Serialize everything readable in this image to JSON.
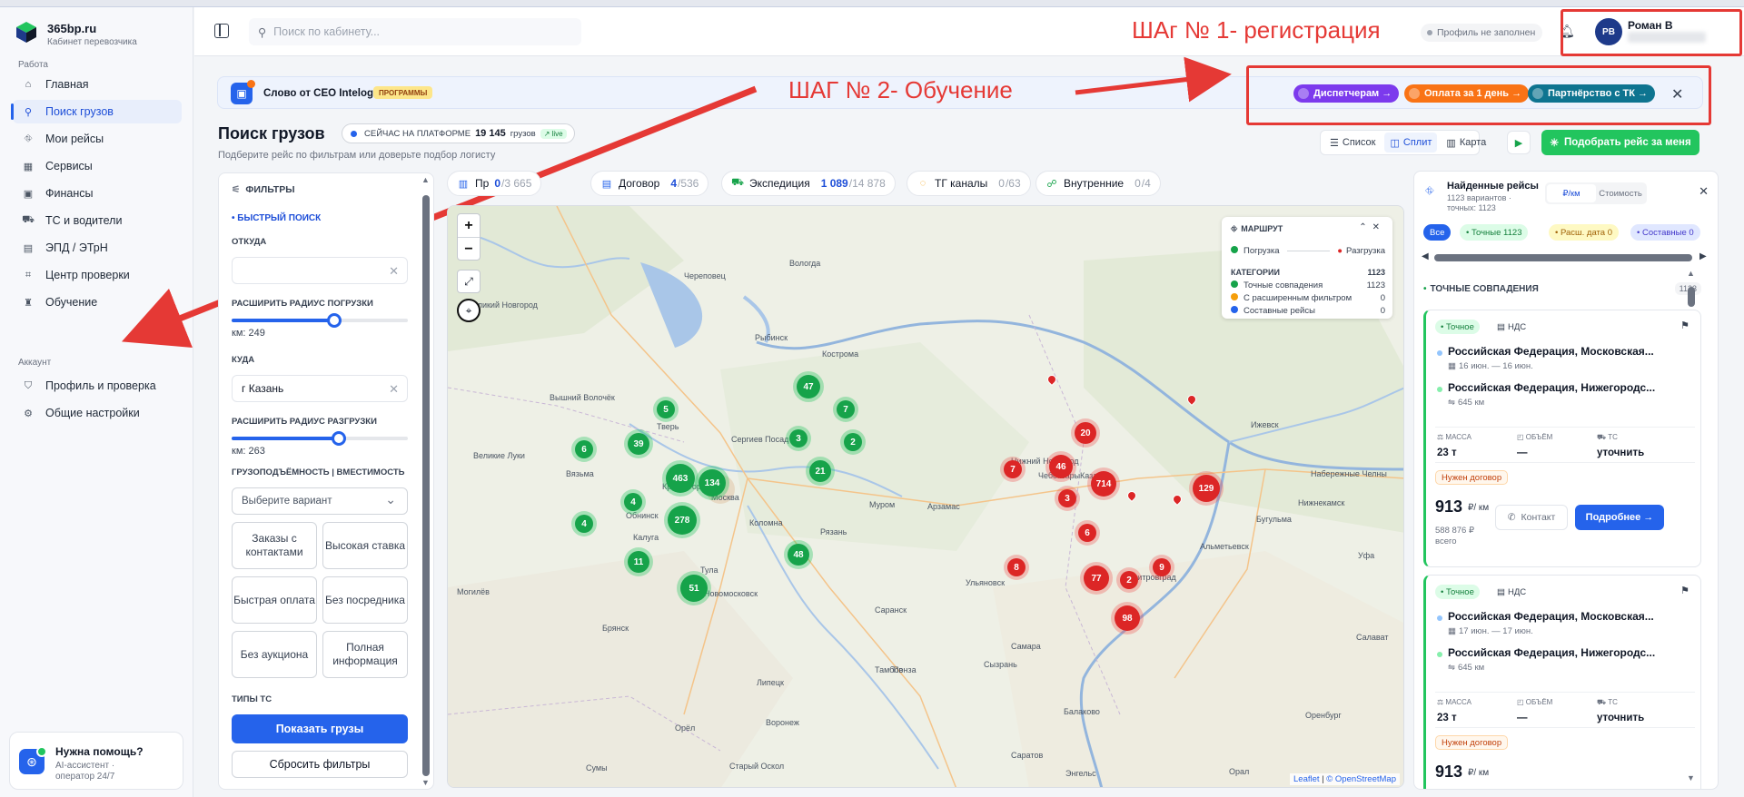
{
  "sidebar": {
    "brand": "365bp.ru",
    "brand_sub": "Кабинет перевозчика",
    "section_work": "Работа",
    "items": [
      {
        "label": "Главная",
        "icon": "home-icon"
      },
      {
        "label": "Поиск грузов",
        "icon": "search-icon"
      },
      {
        "label": "Мои рейсы",
        "icon": "route-icon"
      },
      {
        "label": "Сервисы",
        "icon": "grid-icon"
      },
      {
        "label": "Финансы",
        "icon": "wallet-icon"
      },
      {
        "label": "ТС и водители",
        "icon": "truck-icon"
      },
      {
        "label": "ЭПД / ЭТрН",
        "icon": "document-icon"
      },
      {
        "label": "Центр проверки",
        "icon": "scan-icon"
      },
      {
        "label": "Обучение",
        "icon": "graduation-icon"
      }
    ],
    "section_account": "Аккаунт",
    "account_items": [
      {
        "label": "Профиль и проверка",
        "icon": "shield-icon"
      },
      {
        "label": "Общие настройки",
        "icon": "gear-icon"
      }
    ],
    "help": {
      "title": "Нужна помощь?",
      "subtitle": "AI-ассистент · оператор 24/7"
    }
  },
  "header": {
    "search_placeholder": "Поиск по кабинету...",
    "profile_status": "Профиль не заполнен",
    "avatar_initials": "РВ",
    "user_name": "Роман В"
  },
  "annotations": {
    "step1": "ШАг № 1- регистрация",
    "step2": "ШАГ № 2- Обучение"
  },
  "banner": {
    "title": "Слово от CEO Intelogis",
    "tag": "ПРОГРАММЫ",
    "pills": [
      {
        "label": "Диспетчерам →",
        "color": "#7c3aed"
      },
      {
        "label": "Оплата за 1 день →",
        "color": "#f97316"
      },
      {
        "label": "Партнёрство с ТК →",
        "color": "#0e7490"
      }
    ]
  },
  "page": {
    "title": "Поиск грузов",
    "live_label": "СЕЙЧАС НА ПЛАТФОРМЕ",
    "live_count": "19 145",
    "live_unit": "грузов",
    "live_badge": "↗ live",
    "subtitle": "Подберите рейс по фильтрам или доверьте подбор логисту",
    "views": [
      "Список",
      "Сплит",
      "Карта"
    ],
    "pick_button": "Подобрать рейс за меня"
  },
  "filters": {
    "title": "ФИЛЬТРЫ",
    "quick": "• БЫСТРЫЙ ПОИСК",
    "from_label": "ОТКУДА",
    "from_value": "",
    "radius_load_label": "РАСШИРИТЬ РАДИУС ПОГРУЗКИ",
    "radius_load_value": "км: 249",
    "radius_load_fraction": 0.58,
    "to_label": "КУДА",
    "to_value": "г Казань",
    "radius_unload_label": "РАСШИРИТЬ РАДИУС РАЗГРУЗКИ",
    "radius_unload_value": "км: 263",
    "radius_unload_fraction": 0.61,
    "capacity_label": "ГРУЗОПОДЪЁМНОСТЬ | ВМЕСТИМОСТЬ",
    "capacity_placeholder": "Выберите вариант",
    "chips": [
      "Заказы с контактами",
      "Высокая ставка",
      "Быстрая оплата",
      "Без посредника",
      "Без аукциона",
      "Полная информация"
    ],
    "types_label": "ТИПЫ ТС",
    "show_button": "Показать грузы",
    "reset_button": "Сбросить фильтры"
  },
  "source_tabs": [
    {
      "label": "Пр",
      "count": "0",
      "total": "/3 665"
    },
    {
      "label": "Договор",
      "count": "4",
      "total": "/536"
    },
    {
      "label": "Экспедиция",
      "count": "1 089",
      "total": "/14 878"
    },
    {
      "label": "ТГ каналы",
      "count": "0",
      "total": "/63"
    },
    {
      "label": "Внутренние",
      "count": "0",
      "total": "/4"
    }
  ],
  "map": {
    "zoom_in": "+",
    "zoom_out": "−",
    "attribution_leaflet": "Leaflet",
    "attribution_osm": "© OpenStreetMap",
    "cities": [
      "Вологда",
      "Череповец",
      "Кострома",
      "Великий Новгород",
      "Рыбинск",
      "Тверь",
      "Сергиев Посад",
      "Москва",
      "Коломна",
      "Калуга",
      "Тула",
      "Рязань",
      "Муром",
      "Арзамас",
      "Нижний Новгород",
      "Чебоксары",
      "Казань",
      "Ижевск",
      "Набережные Челны",
      "Нижнекамск",
      "Ульяновск",
      "Саранск",
      "Пенза",
      "Самара",
      "Сызрань",
      "Уфа",
      "Брянск",
      "Орёл",
      "Липецк",
      "Воронеж",
      "Балаково",
      "Саратов",
      "Оренбург",
      "Вязьма",
      "Великие Луки",
      "Вышний Волочёк",
      "Новомосковск",
      "Старый Оскол",
      "Сумы",
      "Могилёв",
      "Тамбов",
      "Димитровград",
      "Альметьевск",
      "Бугульма",
      "Энгельс",
      "Обнинск",
      "Красногорск",
      "Салават",
      "Орал"
    ],
    "legend": {
      "title": "МАРШРУТ",
      "load": "Погрузка",
      "unload": "Разгрузка",
      "cat_label": "КАТЕГОРИИ",
      "cat_total": "1123",
      "rows": [
        {
          "label": "Точные совпадения",
          "value": "1123",
          "color": "#16a34a"
        },
        {
          "label": "С расширенным фильтром",
          "value": "0",
          "color": "#f59e0b"
        },
        {
          "label": "Составные рейсы",
          "value": "0",
          "color": "#2563eb"
        }
      ]
    },
    "green_clusters": [
      "47",
      "5",
      "7",
      "6",
      "39",
      "3",
      "2",
      "463",
      "134",
      "21",
      "4",
      "4",
      "278",
      "11",
      "48",
      "51"
    ],
    "red_clusters": [
      "20",
      "7",
      "46",
      "3",
      "714",
      "129",
      "6",
      "8",
      "77",
      "2",
      "9",
      "98"
    ]
  },
  "results": {
    "title": "Найденные рейсы",
    "subtitle": "1123 вариантов · точных: 1123",
    "mode": [
      "₽/км",
      "Стоимость"
    ],
    "tags": [
      {
        "label": "Все",
        "bg": "#2563eb",
        "fg": "#ffffff"
      },
      {
        "label": "• Точные 1123",
        "bg": "#dcfce7",
        "fg": "#15803d"
      },
      {
        "label": "• Расш. дата 0",
        "bg": "#fef9c3",
        "fg": "#a16207"
      },
      {
        "label": "• Составные 0",
        "bg": "#e0e7ff",
        "fg": "#4338ca"
      }
    ],
    "section": "ТОЧНЫЕ СОВПАДЕНИЯ",
    "section_count": "1123",
    "cards": [
      {
        "tag": "• Точное",
        "vat": "НДС",
        "from": "Российская Федерация, Московская...",
        "dates": "16 июн. — 16 июн.",
        "to": "Российская Федерация, Нижегородс...",
        "distance": "645 км",
        "mass_label": "МАССА",
        "mass": "23 т",
        "volume_label": "ОБЪЁМ",
        "volume": "—",
        "ts_label": "ТС",
        "ts": "уточнить",
        "need": "Нужен договор",
        "price": "913",
        "price_unit": "₽/ км",
        "total": "588 876 ₽",
        "total_label": "всего",
        "contact": "Контакт",
        "more": "Подробнее →"
      },
      {
        "tag": "• Точное",
        "vat": "НДС",
        "from": "Российская Федерация, Московская...",
        "dates": "17 июн. — 17 июн.",
        "to": "Российская Федерация, Нижегородс...",
        "distance": "645 км",
        "mass_label": "МАССА",
        "mass": "23 т",
        "volume_label": "ОБЪЁМ",
        "volume": "—",
        "ts_label": "ТС",
        "ts": "уточнить",
        "need": "Нужен договор",
        "price": "913",
        "price_unit": "₽/ км"
      }
    ]
  }
}
